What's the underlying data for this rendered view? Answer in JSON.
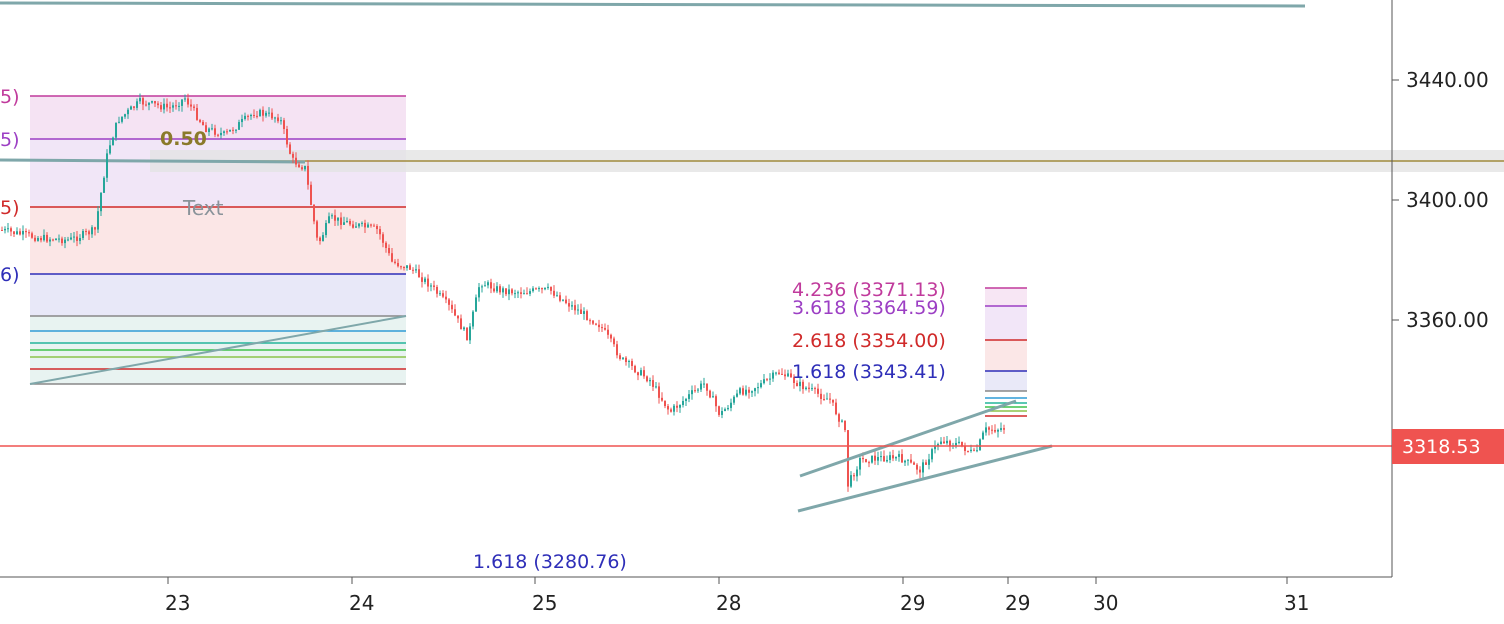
{
  "chart_data": {
    "type": "candlestick",
    "x_tick_labels": [
      "23",
      "24",
      "25",
      "28",
      "29",
      "29",
      "30",
      "31"
    ],
    "y_ticks": [
      3440,
      3400,
      3360
    ],
    "y_tick_labels": [
      "3440.00",
      "3400.00",
      "3360.00"
    ],
    "last_price": 3318.53,
    "last_price_label": "3318.53",
    "colors": {
      "up": "#26a69a",
      "down": "#ef5350",
      "price_line": "#ef5350",
      "trend": "#7fa7aa"
    },
    "fib_right": [
      {
        "text": "4.236 (3371.13)",
        "price": 3371.13,
        "color": "#c03a9c"
      },
      {
        "text": "3.618 (3364.59)",
        "price": 3364.59,
        "color": "#9c3fc4"
      },
      {
        "text": "2.618 (3354.00)",
        "price": 3354.0,
        "color": "#d02a2a"
      },
      {
        "text": "1.618 (3343.41)",
        "price": 3343.41,
        "color": "#2e2eb8"
      }
    ],
    "fib_bottom": [
      {
        "text": "1.618 (3280.76)",
        "price": 3280.76,
        "color": "#2e2eb8"
      }
    ],
    "fib_left_fragments": [
      {
        "text": "5)",
        "color": "#c03a9c"
      },
      {
        "text": "5)",
        "color": "#9c3fc4"
      },
      {
        "text": "5)",
        "color": "#d02a2a"
      },
      {
        "text": "6)",
        "color": "#2e2eb8"
      }
    ],
    "text_annotation": "Text",
    "overlap_fib_label": "0.50"
  }
}
